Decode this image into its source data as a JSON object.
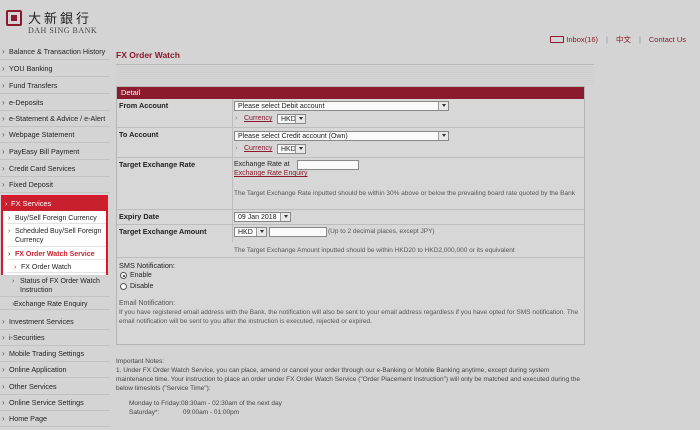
{
  "header": {
    "logo_cn": "大新銀行",
    "logo_en": "DAH SING BANK",
    "inbox": "Inbox(16)",
    "lang": "中文",
    "contact": "Contact Us"
  },
  "sidebar": {
    "items_top": [
      "Balance & Transaction History",
      "YOU Banking",
      "Fund Transfers",
      "e-Deposits",
      "e-Statement & Advice / e-Alert",
      "Webpage Statement",
      "PayEasy Bill Payment",
      "Credit Card Services",
      "Fixed Deposit"
    ],
    "fx_head": "FX Services",
    "fx_sub": [
      "Buy/Sell Foreign Currency",
      "Scheduled Buy/Sell Foreign Currency",
      "FX Order Watch Service",
      "FX Order Watch"
    ],
    "fx_below": [
      "Status of FX Order Watch Instruction",
      "Exchange Rate Enquiry"
    ],
    "items_bottom": [
      "Investment Services",
      "i-Securities",
      "Mobile Trading Settings",
      "Online Application",
      "Other Services",
      "Online Service Settings",
      "Home Page"
    ]
  },
  "main": {
    "title": "FX Order Watch",
    "detail": "Detail",
    "from_label": "From Account",
    "from_select": "Please select Debit account",
    "to_label": "To Account",
    "to_select": "Please select Credit account (Own)",
    "currency_link": "Currency",
    "currency_value": "HKD",
    "rate_label": "Target Exchange Rate",
    "rate_prefix": "Exchange Rate at",
    "rate_enquiry": "Exchange Rate Enquiry",
    "rate_note": "The Target Exchange Rate inputted should be within 30% above or below the prevailing board rate quoted by the Bank",
    "expiry_label": "Expiry Date",
    "expiry_value": "09 Jan 2018",
    "amount_label": "Target Exchange Amount",
    "amount_currency": "HKD",
    "amount_hint": "(Up to 2 decimal places, except JPY)",
    "amount_note": "The Target Exchange Amount inputted should be within HKD20 to HKD2,000,000 or its equivalent",
    "sms_label": "SMS Notification:",
    "enable": "Enable",
    "disable": "Disable",
    "email_label": "Email Notification:",
    "email_note": "If you have registered email address with the Bank, the notification will also be sent to your email address regardless if you have opted for SMS notification. The email notification will be sent to you after the instruction is executed, rejected or expired."
  },
  "notes": {
    "heading": "Important Notes:",
    "item1": "1.   Under FX Order Watch Service, you can place, amend or cancel your order through our e-Banking or Mobile Banking anytime, except during system maintenance time. Your instruction to place an order under FX Order Watch Service (\"Order Placement Instruction\") will only be matched and executed during the below timeslots (\"Service Time\"):",
    "time1": "Monday to Friday:08:30am - 02:30am of the next day",
    "time2": "Saturday*:             09:00am - 01:00pm"
  }
}
